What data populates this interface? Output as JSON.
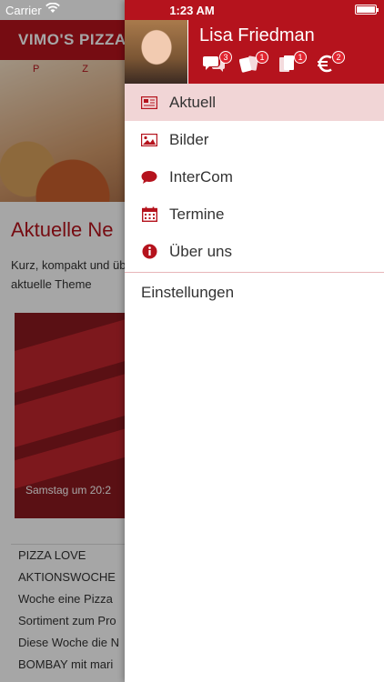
{
  "status_bar": {
    "carrier": "Carrier",
    "time": "1:23 AM"
  },
  "background": {
    "app_title": "VIMO'S PIZZA",
    "hero_letters": "P Z Z",
    "heading": "Aktuelle Ne",
    "subtitle": "Kurz, kompakt und über aktuelle Theme",
    "poster_caption": "Samstag um 20:2",
    "text_lines": [
      "PIZZA LOVE",
      "AKTIONSWOCHE",
      "Woche eine Pizza",
      "Sortiment zum Pro",
      "Diese Woche die N",
      "BOMBAY mit mari"
    ]
  },
  "drawer": {
    "user_name": "Lisa Friedman",
    "header_icons": [
      {
        "icon": "chat-bubbles-icon",
        "badge": "3"
      },
      {
        "icon": "cards-icon",
        "badge": "1"
      },
      {
        "icon": "documents-icon",
        "badge": "1"
      },
      {
        "icon": "euro-icon",
        "badge": "2"
      }
    ],
    "menu": [
      {
        "label": "Aktuell",
        "icon": "newspaper-icon",
        "active": true
      },
      {
        "label": "Bilder",
        "icon": "image-icon",
        "active": false
      },
      {
        "label": "InterCom",
        "icon": "speech-bubble-icon",
        "active": false
      },
      {
        "label": "Termine",
        "icon": "calendar-icon",
        "active": false
      },
      {
        "label": "Über uns",
        "icon": "info-icon",
        "active": false
      }
    ],
    "settings_label": "Einstellungen"
  },
  "colors": {
    "accent": "#b5131d",
    "active_row": "#f1d5d6"
  }
}
